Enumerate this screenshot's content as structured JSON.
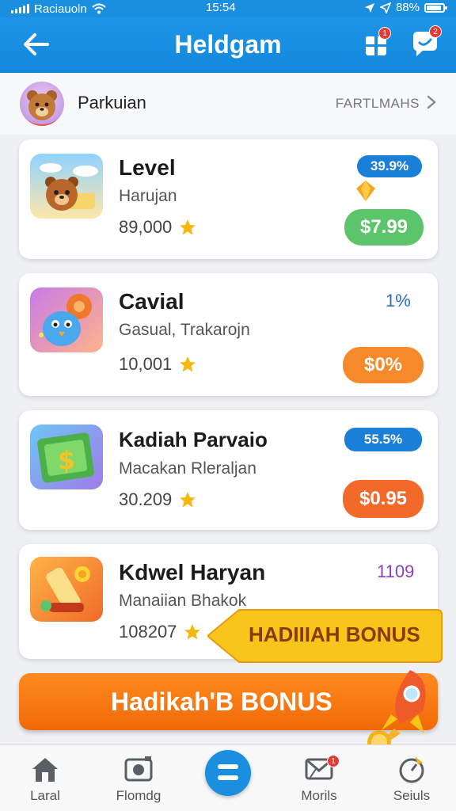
{
  "status": {
    "carrier": "Raciauoln",
    "time": "15:54",
    "battery": "88%"
  },
  "header": {
    "title": "Heldgam",
    "bell_badge": "1",
    "chat_badge": "2"
  },
  "profile": {
    "name": "Parkuian",
    "link": "FARTLMAHS"
  },
  "cards": [
    {
      "name": "Level",
      "sub": "Harujan",
      "count": "89,000",
      "tag": "39.9%",
      "price": "$7.99",
      "tag_color": "#1a7fd6",
      "price_color": "#5cc46a"
    },
    {
      "name": "Cavial",
      "sub": "Gasual, Trakarojn",
      "count": "10,001",
      "tag": "1%",
      "price": "$0%",
      "tag_color": "#2b6cc4",
      "price_color": "#f68a2a"
    },
    {
      "name": "Kadiah Parvaio",
      "sub": "Macakan Rleraljan",
      "count": "30.209",
      "tag": "55.5%",
      "price": "$0.95",
      "tag_color": "#1a7fd6",
      "price_color": "#f26a2a"
    },
    {
      "name": "Kdwel Haryan",
      "sub": "Manaiian Bhakok",
      "count": "108207",
      "tag": "1109",
      "tag_color": "#8a3fc2"
    }
  ],
  "bonus": {
    "tag_label": "HADIIIAH BONUS",
    "bar_label": "Hadikah'B BONUS"
  },
  "nav": {
    "items": [
      "Laral",
      "Flomdg",
      "Morils",
      "Seiuls"
    ],
    "morils_badge": "1"
  }
}
